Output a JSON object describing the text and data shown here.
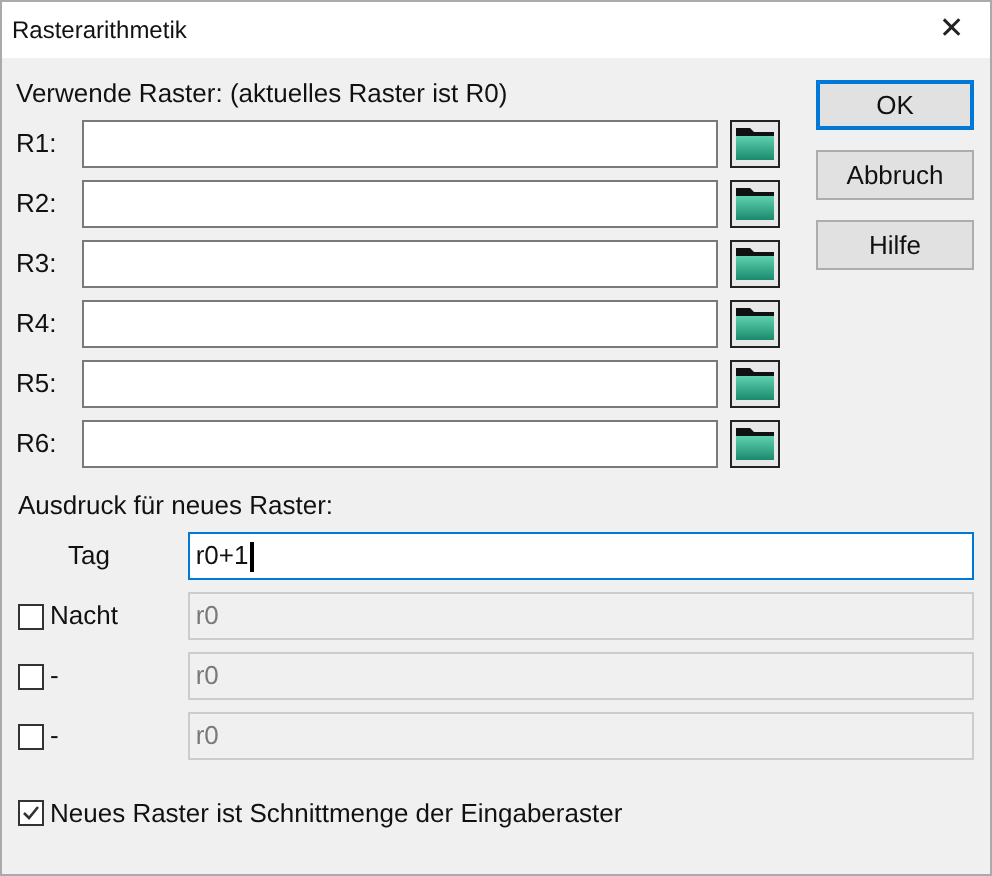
{
  "window": {
    "title": "Rasterarithmetik",
    "close": "✕"
  },
  "rasters": {
    "heading": "Verwende Raster: (aktuelles Raster ist R0)",
    "rows": [
      {
        "label": "R1:"
      },
      {
        "label": "R2:"
      },
      {
        "label": "R3:"
      },
      {
        "label": "R4:"
      },
      {
        "label": "R5:"
      },
      {
        "label": "R6:"
      }
    ]
  },
  "buttons": [
    {
      "label": "OK",
      "selected": true
    },
    {
      "label": "Abbruch",
      "selected": false
    },
    {
      "label": "Hilfe",
      "selected": false
    }
  ],
  "expression": {
    "heading": "Ausdruck für neues Raster:",
    "rows": [
      {
        "kind": "label",
        "label": "Tag",
        "value": "r0+1"
      },
      {
        "kind": "checkbox",
        "label": "Nacht",
        "checked": false,
        "value": "r0"
      },
      {
        "kind": "checkbox",
        "label": "-",
        "checked": false,
        "value": "r0"
      },
      {
        "kind": "checkbox",
        "label": "-",
        "checked": false,
        "value": "r0"
      }
    ]
  },
  "intersection": {
    "label": "Neues Raster ist Schnittmenge der Eingaberaster",
    "checked": true
  }
}
